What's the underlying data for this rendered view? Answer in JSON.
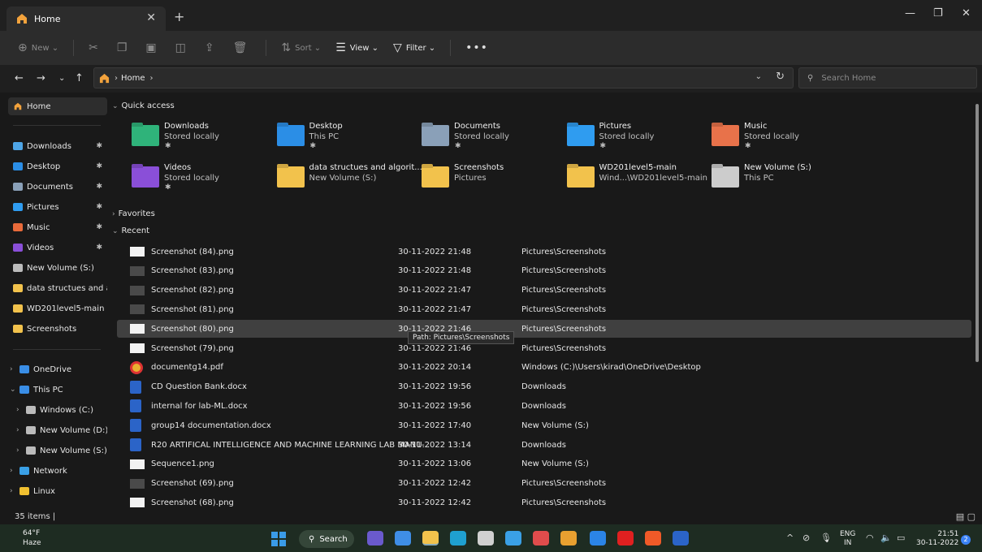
{
  "tab": {
    "title": "Home",
    "close": "✕",
    "new": "+"
  },
  "window": {
    "minimize": "—",
    "restore": "❐",
    "close": "✕"
  },
  "toolbar": {
    "new_label": "New",
    "sort_label": "Sort",
    "view_label": "View",
    "filter_label": "Filter",
    "more_label": "•••"
  },
  "address": {
    "crumb": "Home",
    "chev": "›"
  },
  "search": {
    "placeholder": "Search Home"
  },
  "sidebar": {
    "home": "Home",
    "pinned": [
      {
        "label": "Downloads",
        "color": "#4ea5e6"
      },
      {
        "label": "Desktop",
        "color": "#2b8ee6"
      },
      {
        "label": "Documents",
        "color": "#8aa0b8"
      },
      {
        "label": "Pictures",
        "color": "#2f9cf0"
      },
      {
        "label": "Music",
        "color": "#e86a3a"
      },
      {
        "label": "Videos",
        "color": "#8a4fd8"
      }
    ],
    "drives_recent": [
      {
        "label": "New Volume (S:)",
        "color": "#bbbbbb"
      },
      {
        "label": "data structues and algorithms",
        "color": "#f2c24c"
      },
      {
        "label": "WD201level5-main",
        "color": "#f2c24c"
      },
      {
        "label": "Screenshots",
        "color": "#f2c24c"
      }
    ],
    "tree": [
      {
        "label": "OneDrive",
        "color": "#3a8ee6",
        "indent": 0
      },
      {
        "label": "This PC",
        "color": "#3a8ee6",
        "indent": 0
      },
      {
        "label": "Windows (C:)",
        "color": "#bbbbbb",
        "indent": 1
      },
      {
        "label": "New Volume (D:)",
        "color": "#bbbbbb",
        "indent": 1
      },
      {
        "label": "New Volume (S:)",
        "color": "#bbbbbb",
        "indent": 1
      },
      {
        "label": "Network",
        "color": "#3aa0e6",
        "indent": 0
      },
      {
        "label": "Linux",
        "color": "#f0c030",
        "indent": 0
      }
    ]
  },
  "quick_access": {
    "title": "Quick access",
    "tiles": [
      {
        "name": "Downloads",
        "sub": "Stored locally",
        "pinned": true,
        "color": "#2fb37a"
      },
      {
        "name": "Desktop",
        "sub": "This PC",
        "pinned": true,
        "color": "#2b8ee6"
      },
      {
        "name": "Documents",
        "sub": "Stored locally",
        "pinned": true,
        "color": "#8aa0b8"
      },
      {
        "name": "Pictures",
        "sub": "Stored locally",
        "pinned": true,
        "color": "#2f9cf0"
      },
      {
        "name": "Music",
        "sub": "Stored locally",
        "pinned": true,
        "color": "#e8724a"
      },
      {
        "name": "Videos",
        "sub": "Stored locally",
        "pinned": true,
        "color": "#8a4fd8"
      },
      {
        "name": "data structues and algorit...",
        "sub": "New Volume (S:)",
        "pinned": false,
        "color": "#f2c24c"
      },
      {
        "name": "Screenshots",
        "sub": "Pictures",
        "pinned": false,
        "color": "#f2c24c"
      },
      {
        "name": "WD201level5-main",
        "sub": "Wind...\\WD201level5-main",
        "pinned": false,
        "color": "#f2c24c"
      },
      {
        "name": "New Volume (S:)",
        "sub": "This PC",
        "pinned": false,
        "color": "#cccccc"
      }
    ],
    "pin_glyph": "📌"
  },
  "favorites": {
    "title": "Favorites"
  },
  "recent": {
    "title": "Recent",
    "items": [
      {
        "name": "Screenshot (84).png",
        "date": "30-11-2022 21:48",
        "location": "Pictures\\Screenshots",
        "kind": "image"
      },
      {
        "name": "Screenshot (83).png",
        "date": "30-11-2022 21:48",
        "location": "Pictures\\Screenshots",
        "kind": "image-dark"
      },
      {
        "name": "Screenshot (82).png",
        "date": "30-11-2022 21:47",
        "location": "Pictures\\Screenshots",
        "kind": "image-dark"
      },
      {
        "name": "Screenshot (81).png",
        "date": "30-11-2022 21:47",
        "location": "Pictures\\Screenshots",
        "kind": "image-dark"
      },
      {
        "name": "Screenshot (80).png",
        "date": "30-11-2022 21:46",
        "location": "Pictures\\Screenshots",
        "kind": "image"
      },
      {
        "name": "Screenshot (79).png",
        "date": "30-11-2022 21:46",
        "location": "Pictures\\Screenshots",
        "kind": "image"
      },
      {
        "name": "documentg14.pdf",
        "date": "30-11-2022 20:14",
        "location": "Windows (C:)\\Users\\kirad\\OneDrive\\Desktop",
        "kind": "chrome"
      },
      {
        "name": "CD Question Bank.docx",
        "date": "30-11-2022 19:56",
        "location": "Downloads",
        "kind": "word"
      },
      {
        "name": "internal for lab-ML.docx",
        "date": "30-11-2022 19:56",
        "location": "Downloads",
        "kind": "word"
      },
      {
        "name": "group14 documentation.docx",
        "date": "30-11-2022 17:40",
        "location": "New Volume (S:)",
        "kind": "word"
      },
      {
        "name": "R20 ARTIFICAL INTELLIGENCE AND MACHINE LEARNING LAB MANU...",
        "date": "30-11-2022 13:14",
        "location": "Downloads",
        "kind": "word"
      },
      {
        "name": "Sequence1.png",
        "date": "30-11-2022 13:06",
        "location": "New Volume (S:)",
        "kind": "image"
      },
      {
        "name": "Screenshot (69).png",
        "date": "30-11-2022 12:42",
        "location": "Pictures\\Screenshots",
        "kind": "image-dark"
      },
      {
        "name": "Screenshot (68).png",
        "date": "30-11-2022 12:42",
        "location": "Pictures\\Screenshots",
        "kind": "image"
      }
    ],
    "highlighted_index": 4
  },
  "tooltip": "Path: Pictures\\Screenshots",
  "status": {
    "count": "35 items  |"
  },
  "taskbar": {
    "weather_temp": "64°F",
    "weather_desc": "Haze",
    "search_label": "Search",
    "lang_top": "ENG",
    "lang_bottom": "IN",
    "time": "21:51",
    "date": "30-11-2022",
    "notifications": "2",
    "apps": [
      "#2b84e6",
      "#7a86a0",
      "#6a5acd",
      "#3f8ee6",
      "#f2c24c",
      "#1fa0d0",
      "#d0d0d0",
      "#3aa0e6",
      "#e04c4c",
      "#e8a030",
      "#2b84e6",
      "#e02020",
      "#f05a28",
      "#2b64c8"
    ]
  }
}
